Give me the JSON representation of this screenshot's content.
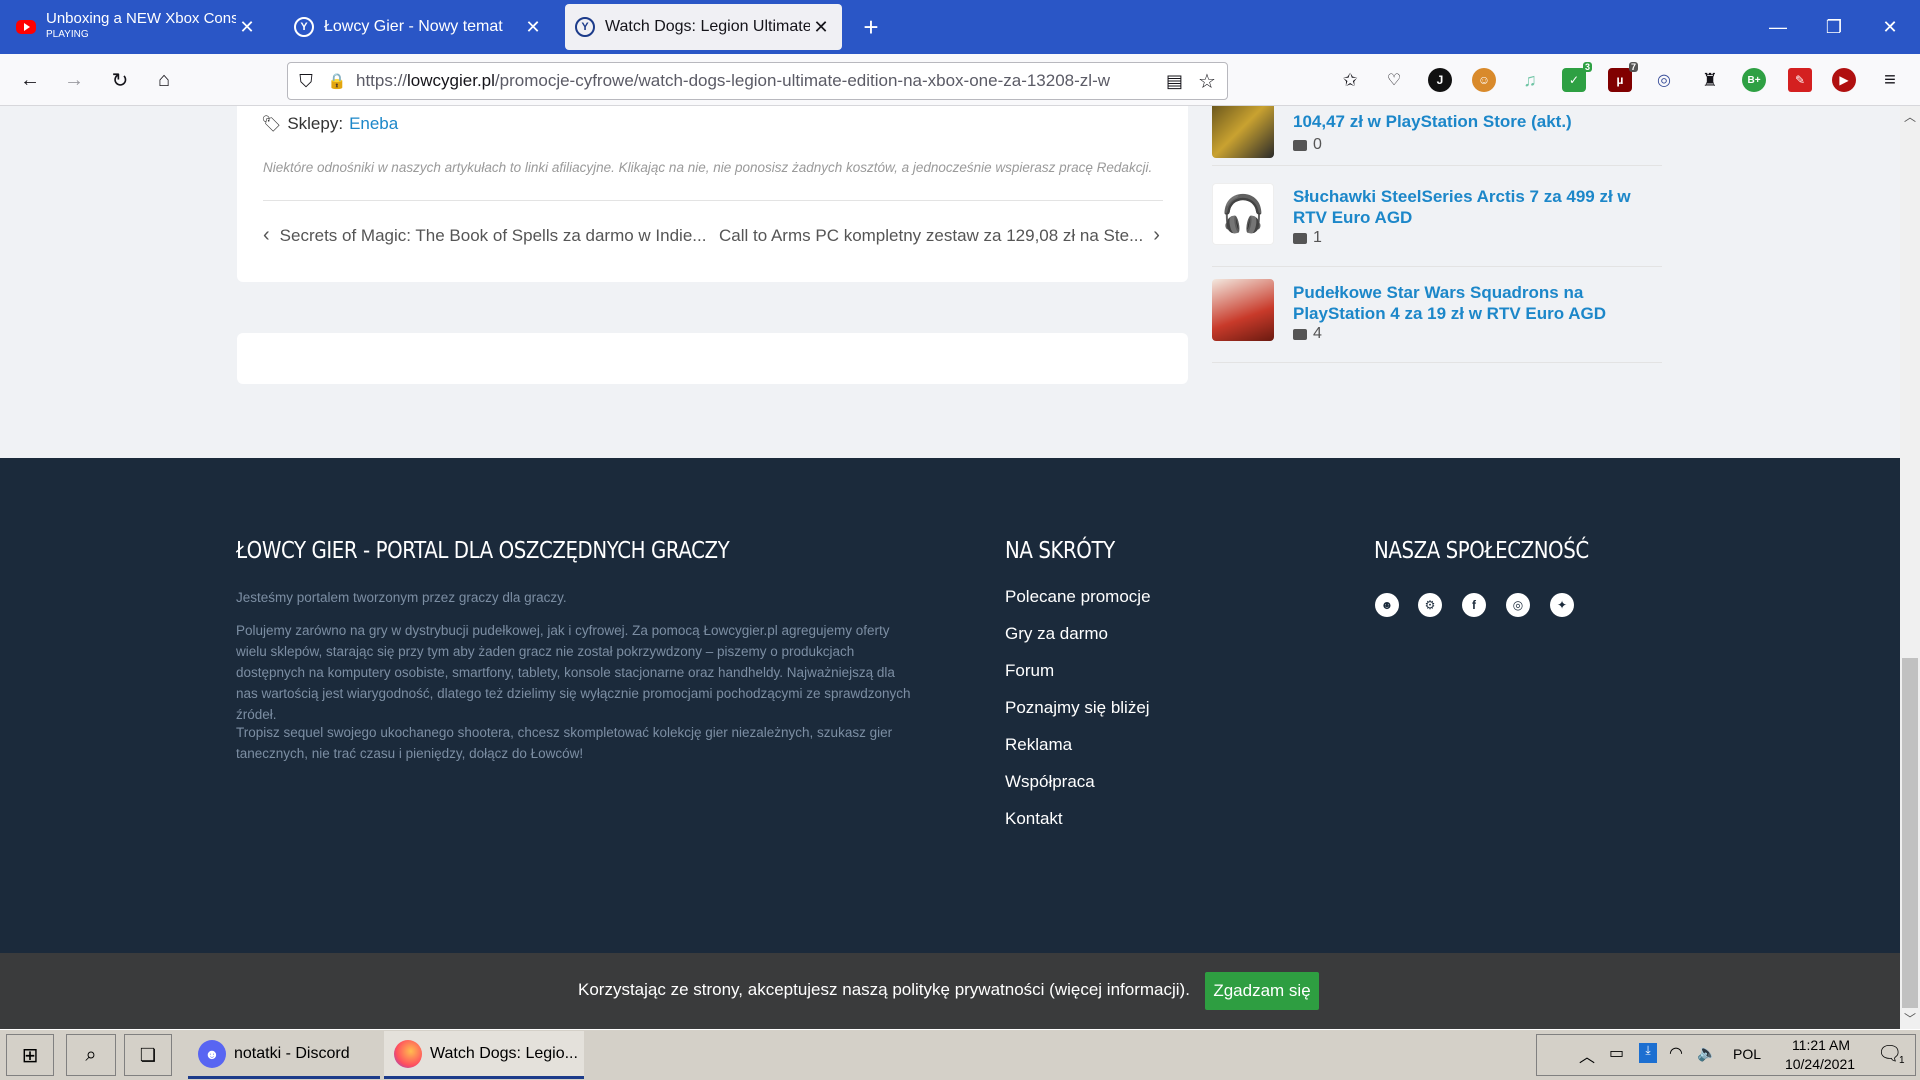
{
  "browser": {
    "tabs": [
      {
        "title": "Unboxing a NEW Xbox Console",
        "sub": "PLAYING",
        "icon": "youtube-icon"
      },
      {
        "title": "Łowcy Gier - Nowy temat",
        "icon": "lowcy-gier-icon"
      },
      {
        "title": "Watch Dogs: Legion Ultimate Edition",
        "icon": "lowcy-gier-icon"
      }
    ],
    "url_prefix": "https://",
    "url_host": "lowcygier.pl",
    "url_path": "/promocje-cyfrowe/watch-dogs-legion-ultimate-edition-na-xbox-one-za-13208-zl-w",
    "ext_badges": {
      "shield": "3",
      "ublock": "7"
    }
  },
  "article": {
    "stores_label": "Sklepy:",
    "store_link": "Eneba",
    "affiliate_note": "Niektóre odnośniki w naszych artykułach to linki afiliacyjne. Klikając na nie, nie ponosisz żadnych kosztów, a jednocześnie wspierasz pracę Redakcji.",
    "prev_post": "Secrets of Magic: The Book of Spells za darmo w Indie...",
    "next_post": "Call to Arms PC kompletny zestaw za 129,08 zł na Ste..."
  },
  "sidebar": {
    "items": [
      {
        "title": "104,47 zł w PlayStation Store (akt.)",
        "comments": "0"
      },
      {
        "title": "Słuchawki SteelSeries Arctis 7 za 499 zł w RTV Euro AGD",
        "comments": "1"
      },
      {
        "title": "Pudełkowe Star Wars Squadrons na PlayStation 4 za 19 zł w RTV Euro AGD",
        "comments": "4"
      }
    ]
  },
  "footer": {
    "about_heading": "ŁOWCY GIER - PORTAL DLA OSZCZĘDNYCH GRACZY",
    "about_p1": "Jesteśmy portalem tworzonym przez graczy dla graczy.",
    "about_p2": "Polujemy zarówno na gry w dystrybucji pudełkowej, jak i cyfrowej. Za pomocą Łowcygier.pl agregujemy oferty wielu sklepów, starając się przy tym aby żaden gracz nie został pokrzywdzony – piszemy o produkcjach dostępnych na komputery osobiste, smartfony, tablety, konsole stacjonarne oraz handheldy. Najważniejszą dla nas wartością jest wiarygodność, dlatego też dzielimy się wyłącznie promocjami pochodzącymi ze sprawdzonych źródeł.",
    "about_p3": "Tropisz sequel swojego ukochanego shootera, chcesz skompletować kolekcję gier niezależnych, szukasz gier tanecznych, nie trać czasu i pieniędzy, dołącz do Łowców!",
    "shortcuts_heading": "NA SKRÓTY",
    "shortcuts": [
      "Polecane promocje",
      "Gry za darmo",
      "Forum",
      "Poznajmy się bliżej",
      "Reklama",
      "Współpraca",
      "Kontakt"
    ],
    "community_heading": "NASZA SPOŁECZNOŚĆ",
    "social_icons": [
      "discord-icon",
      "steam-icon",
      "facebook-icon",
      "instagram-icon",
      "twitter-icon"
    ]
  },
  "cookie": {
    "message": "Korzystając ze strony, akceptujesz naszą politykę prywatności (więcej informacji).",
    "accept": "Zgadzam się"
  },
  "taskbar": {
    "apps": [
      {
        "label": "notatki - Discord",
        "icon": "discord-icon"
      },
      {
        "label": "Watch Dogs: Legio...",
        "icon": "firefox-icon"
      }
    ],
    "lang": "POL",
    "time": "11:21 AM",
    "date": "10/24/2021",
    "notif_count": "1"
  },
  "colors": {
    "tabstrip": "#2a56c6",
    "link": "#1c87c9",
    "footer": "#1b2a3b",
    "accept": "#2e9e41"
  }
}
